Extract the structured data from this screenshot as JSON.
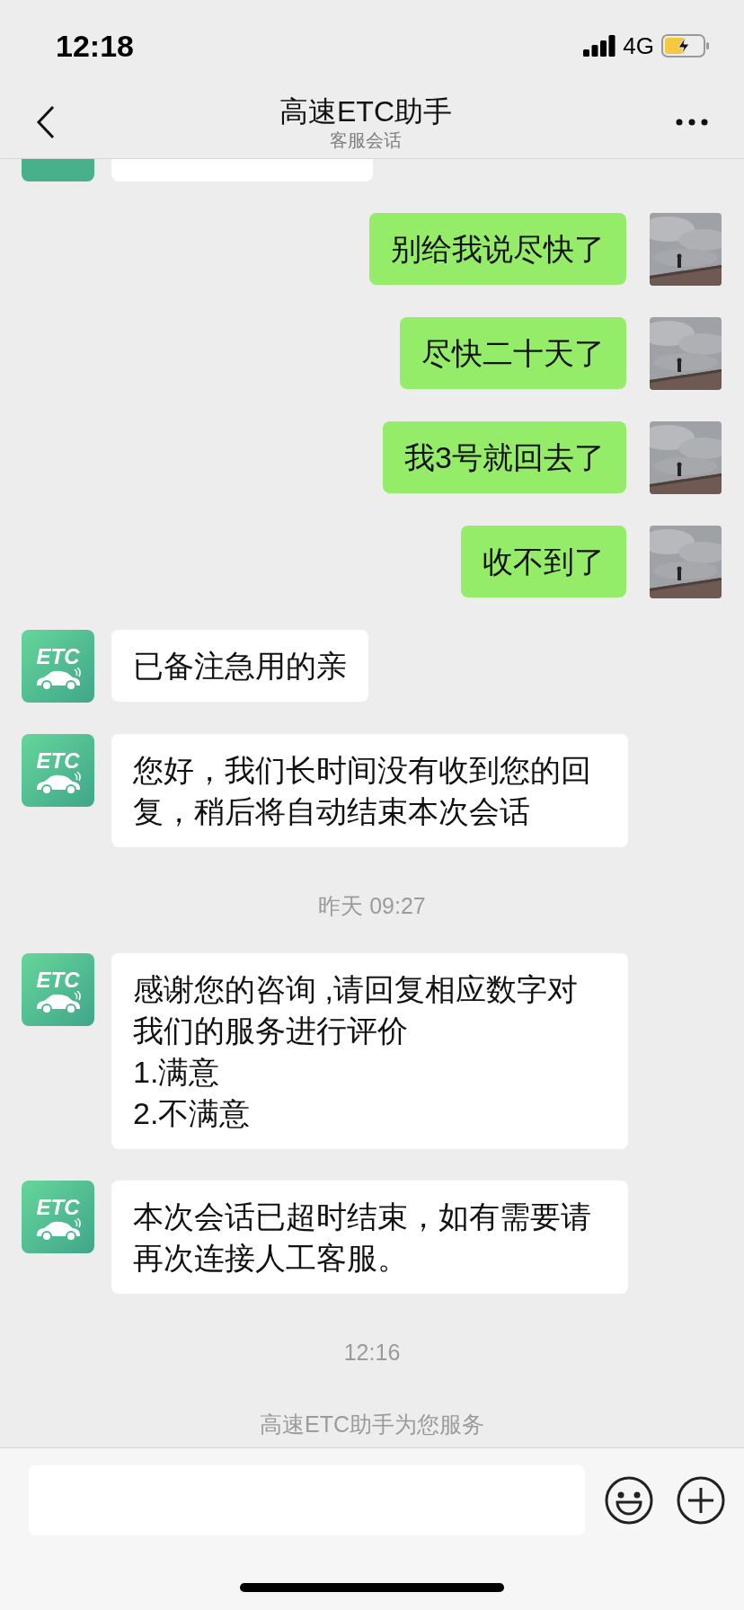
{
  "status_bar": {
    "time": "12:18",
    "network": "4G"
  },
  "header": {
    "title": "高速ETC助手",
    "subtitle": "客服会话"
  },
  "messages": [
    {
      "kind": "hidden_incoming"
    },
    {
      "kind": "outgoing",
      "text": "别给我说尽快了"
    },
    {
      "kind": "outgoing",
      "text": "尽快二十天了"
    },
    {
      "kind": "outgoing",
      "text": "我3号就回去了"
    },
    {
      "kind": "outgoing",
      "text": "收不到了"
    },
    {
      "kind": "incoming",
      "avatar_label": "ETC",
      "text": "已备注急用的亲"
    },
    {
      "kind": "incoming",
      "avatar_label": "ETC",
      "text": "您好，我们长时间没有收到您的回复，稍后将自动结束本次会话"
    },
    {
      "kind": "time",
      "text": "昨天 09:27"
    },
    {
      "kind": "incoming",
      "avatar_label": "ETC",
      "text": "感谢您的咨询 ,请回复相应数字对我们的服务进行评价\n1.满意\n2.不满意"
    },
    {
      "kind": "incoming",
      "avatar_label": "ETC",
      "text": "本次会话已超时结束，如有需要请再次连接人工客服。"
    },
    {
      "kind": "time",
      "text": "12:16"
    },
    {
      "kind": "notice",
      "text": "高速ETC助手为您服务"
    }
  ]
}
